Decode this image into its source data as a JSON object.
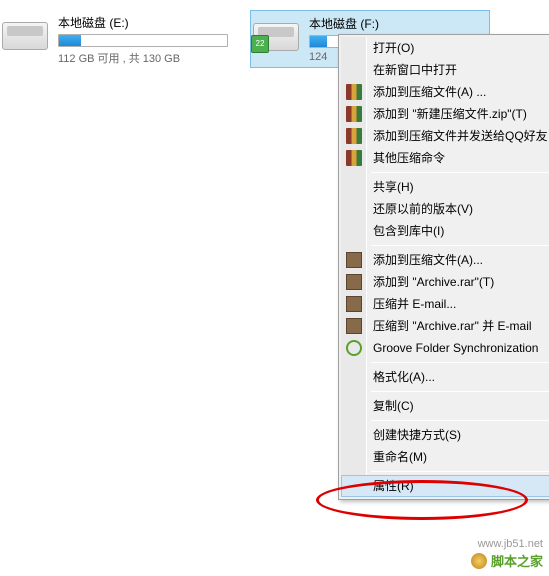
{
  "drives": {
    "e": {
      "title": "本地磁盘 (E:)",
      "sub": "112 GB 可用 , 共 130 GB",
      "fill_percent": 13
    },
    "f": {
      "title": "本地磁盘 (F:)",
      "sub": "124",
      "fill_percent": 10
    }
  },
  "menu": {
    "open": "打开(O)",
    "open_new_window": "在新窗口中打开",
    "add_archive": "添加到压缩文件(A) ...",
    "add_zip": "添加到 \"新建压缩文件.zip\"(T)",
    "add_send_qq": "添加到压缩文件并发送给QQ好友",
    "other_compress": "其他压缩命令",
    "share": "共享(H)",
    "restore_versions": "还原以前的版本(V)",
    "include_library": "包含到库中(I)",
    "add_archive2": "添加到压缩文件(A)...",
    "add_rar": "添加到 \"Archive.rar\"(T)",
    "compress_email": "压缩并 E-mail...",
    "compress_rar_email": "压缩到 \"Archive.rar\" 并 E-mail",
    "groove": "Groove Folder Synchronization",
    "format": "格式化(A)...",
    "copy": "复制(C)",
    "create_shortcut": "创建快捷方式(S)",
    "rename": "重命名(M)",
    "properties": "属性(R)"
  },
  "watermark": {
    "url": "www.jb51.net",
    "site": "脚本之家"
  }
}
